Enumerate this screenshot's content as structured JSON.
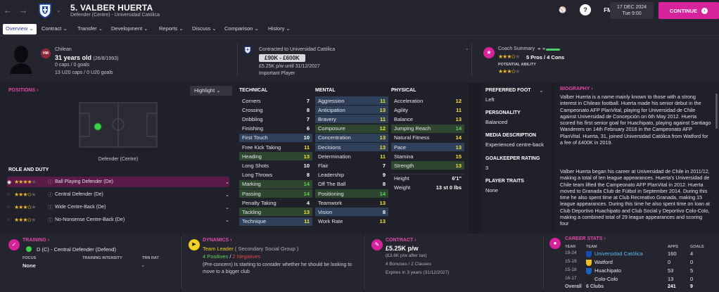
{
  "header": {
    "player_title": "5. VALBER HUERTA",
    "player_subtitle": "Defender (Centre) - Universidad Católica",
    "fm_label": "FM",
    "date_line1": "17 DEC 2024",
    "date_line2": "Tue 9:00",
    "continue_label": "CONTINUE"
  },
  "tabs": [
    "Overview",
    "Contract",
    "Transfer",
    "Development",
    "Reports",
    "Discuss",
    "Comparison",
    "History"
  ],
  "profile": {
    "nationality": "Chilean",
    "age": "31 years old",
    "dob": "(26/8/1993)",
    "caps": "0 caps / 0 goals",
    "u20": "13 U20 caps / 0 U20 goals",
    "badge": "HM"
  },
  "contract_header": {
    "title": "Contracted to Universidad Católica",
    "value_range": "£90K - £600K",
    "wage_line": "£5.25K p/w until 31/12/2027",
    "status": "Important Player"
  },
  "coach_summary": {
    "title": "Coach Summary",
    "pros_cons": "5 Pros / 4 Cons",
    "potential_label": "POTENTIAL ABILITY",
    "ability_stars": 3.5,
    "potential_stars": 3.5
  },
  "positions": {
    "title": "POSITIONS",
    "highlight_label": "Highlight",
    "position_label": "Defender (Centre)"
  },
  "roles": {
    "title": "ROLE AND DUTY",
    "items": [
      {
        "name": "Ball Playing Defender (De)",
        "stars": 4
      },
      {
        "name": "Central Defender (De)",
        "stars": 3.5
      },
      {
        "name": "Wide Centre-Back (De)",
        "stars": 3.5
      },
      {
        "name": "No-Nonsense Centre-Back (De)",
        "stars": 3.5
      }
    ]
  },
  "technical": {
    "title": "TECHNICAL",
    "rows": [
      {
        "name": "Corners",
        "value": "7",
        "hl": ""
      },
      {
        "name": "Crossing",
        "value": "8",
        "hl": ""
      },
      {
        "name": "Dribbling",
        "value": "7",
        "hl": ""
      },
      {
        "name": "Finishing",
        "value": "6",
        "hl": ""
      },
      {
        "name": "First Touch",
        "value": "10",
        "hl": "blue"
      },
      {
        "name": "Free Kick Taking",
        "value": "11",
        "hl": ""
      },
      {
        "name": "Heading",
        "value": "13",
        "hl": "green"
      },
      {
        "name": "Long Shots",
        "value": "10",
        "hl": ""
      },
      {
        "name": "Long Throws",
        "value": "8",
        "hl": ""
      },
      {
        "name": "Marking",
        "value": "14",
        "hl": "green"
      },
      {
        "name": "Passing",
        "value": "14",
        "hl": "green"
      },
      {
        "name": "Penalty Taking",
        "value": "4",
        "hl": ""
      },
      {
        "name": "Tackling",
        "value": "13",
        "hl": "green"
      },
      {
        "name": "Technique",
        "value": "11",
        "hl": "blue"
      }
    ]
  },
  "mental": {
    "title": "MENTAL",
    "rows": [
      {
        "name": "Aggression",
        "value": "11",
        "hl": "blue"
      },
      {
        "name": "Anticipation",
        "value": "13",
        "hl": "blue"
      },
      {
        "name": "Bravery",
        "value": "11",
        "hl": "blue"
      },
      {
        "name": "Composure",
        "value": "12",
        "hl": "green"
      },
      {
        "name": "Concentration",
        "value": "13",
        "hl": "blue"
      },
      {
        "name": "Decisions",
        "value": "13",
        "hl": "blue"
      },
      {
        "name": "Determination",
        "value": "11",
        "hl": ""
      },
      {
        "name": "Flair",
        "value": "7",
        "hl": ""
      },
      {
        "name": "Leadership",
        "value": "9",
        "hl": ""
      },
      {
        "name": "Off The Ball",
        "value": "8",
        "hl": ""
      },
      {
        "name": "Positioning",
        "value": "14",
        "hl": "green"
      },
      {
        "name": "Teamwork",
        "value": "13",
        "hl": ""
      },
      {
        "name": "Vision",
        "value": "8",
        "hl": "blue"
      },
      {
        "name": "Work Rate",
        "value": "13",
        "hl": ""
      }
    ]
  },
  "physical": {
    "title": "PHYSICAL",
    "rows": [
      {
        "name": "Acceleration",
        "value": "12",
        "hl": ""
      },
      {
        "name": "Agility",
        "value": "11",
        "hl": ""
      },
      {
        "name": "Balance",
        "value": "13",
        "hl": ""
      },
      {
        "name": "Jumping Reach",
        "value": "14",
        "hl": "green"
      },
      {
        "name": "Natural Fitness",
        "value": "14",
        "hl": ""
      },
      {
        "name": "Pace",
        "value": "13",
        "hl": "blue"
      },
      {
        "name": "Stamina",
        "value": "15",
        "hl": ""
      },
      {
        "name": "Strength",
        "value": "13",
        "hl": "green"
      }
    ],
    "height_label": "Height",
    "height_value": "6'1\"",
    "weight_label": "Weight",
    "weight_value": "13 st 0 lbs"
  },
  "info": {
    "pref_foot_label": "PREFERRED FOOT",
    "pref_foot": "Left",
    "personality_label": "PERSONALITY",
    "personality": "Balanced",
    "media_label": "MEDIA DESCRIPTION",
    "media": "Experienced centre-back",
    "gk_label": "GOALKEEPER RATING",
    "gk": "3",
    "traits_label": "PLAYER TRAITS",
    "traits": "None"
  },
  "biography": {
    "title": "BIOGRAPHY",
    "p1": "Valber Huerta is a name mainly known to those with a strong interest in Chilean football. Huerta made his senior debut in the Campeonato AFP PlanVital, playing for Universidad de Chile against Universidad de Concepción on 6th May 2012. Huerta scored his first senior goal for Huachipato, playing against Santiago Wanderers on 14th February 2016 in the Campeonato AFP PlanVital. Huerta, 31, joined Universidad Católica from Watford for a fee of £400K in 2019.",
    "p2": "Valber Huerta began his career at Universidad de Chile in 2011/12, making a total of ten league appearances. Huerta's Universidad de Chile team lifted the Campeonato AFP PlanVital in 2012. Huerta moved to Granada Club de Fútbol in September 2014. During this time he also spent time at Club Recreativo Granada, making 15 league appearances. During this time he also spent time on loan at Club Deportivo Huachipato and Club Social y Deportivo Colo-Colo, making a combined total of 29 league appearances and scoring four"
  },
  "training": {
    "title": "TRAINING",
    "role": "D (C) - Central Defender (Defend)",
    "focus_label": "FOCUS",
    "focus": "None",
    "intensity_label": "TRAINING INTENSITY",
    "trn_label": "TRN RAT",
    "trn": "-"
  },
  "dynamics": {
    "title": "DYNAMICS",
    "status": "Team Leader",
    "group": "( Secondary Social Group )",
    "positives": "4 Positives",
    "negatives": "2 Negatives",
    "note": "(Pre-concern) Is starting to consider whether he should be looking to move to a bigger club"
  },
  "contract": {
    "title": "CONTRACT",
    "wage": "£5.25K p/w",
    "after_tax": "(£3.6K p/w after tax)",
    "bonuses": "4 Bonuses / 2 Clauses",
    "expires": "Expires in 3 years (31/12/2027)"
  },
  "career": {
    "title": "CAREER STATS",
    "col_year": "YEAR",
    "col_team": "TEAM",
    "col_apps": "APPS",
    "col_goals": "GOALS",
    "rows": [
      {
        "year": "19-24",
        "team": "Universidad Católica",
        "apps": "160",
        "goals": "4",
        "current": true
      },
      {
        "year": "15-19",
        "team": "Watford",
        "apps": "0",
        "goals": "0",
        "current": false
      },
      {
        "year": "15-18",
        "team": "Huachipato",
        "apps": "53",
        "goals": "5",
        "current": false
      },
      {
        "year": "16-17",
        "team": "Colo-Colo",
        "apps": "13",
        "goals": "0",
        "current": false
      }
    ],
    "overall_label": "Overall",
    "overall_team": "6 Clubs",
    "overall_apps": "241",
    "overall_goals": "9"
  },
  "colors": {
    "accent": "#d6239b",
    "highlight_blue": "#2f415a",
    "highlight_green": "#2e4630",
    "value_yellow": "#f5e23a"
  }
}
